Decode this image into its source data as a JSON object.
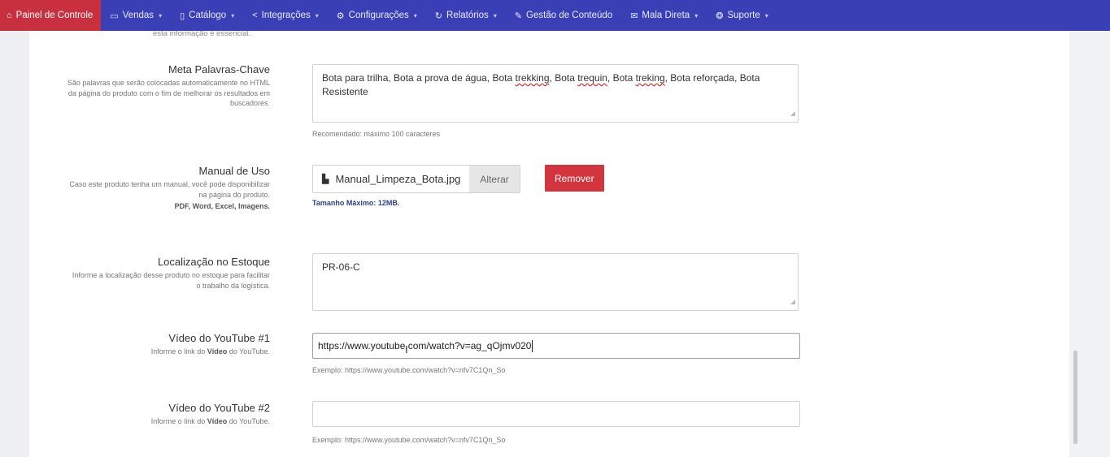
{
  "nav": {
    "items": [
      {
        "label": "Painel de Controle",
        "icon": "home-icon",
        "active": true,
        "has_menu": false
      },
      {
        "label": "Vendas",
        "icon": "cart-icon",
        "active": false,
        "has_menu": true
      },
      {
        "label": "Catálogo",
        "icon": "catalog-icon",
        "active": false,
        "has_menu": true
      },
      {
        "label": "Integrações",
        "icon": "share-icon",
        "active": false,
        "has_menu": true
      },
      {
        "label": "Configurações",
        "icon": "gear-icon",
        "active": false,
        "has_menu": true
      },
      {
        "label": "Relatórios",
        "icon": "history-icon",
        "active": false,
        "has_menu": true
      },
      {
        "label": "Gestão de Conteúdo",
        "icon": "edit-icon",
        "active": false,
        "has_menu": false
      },
      {
        "label": "Mala Direta",
        "icon": "mail-icon",
        "active": false,
        "has_menu": true
      },
      {
        "label": "Suporte",
        "icon": "lifebuoy-icon",
        "active": false,
        "has_menu": true
      }
    ],
    "active_color": "#c9303f",
    "bar_color": "#3a3fb6"
  },
  "cutoff_text": "esta informação é essencial.",
  "meta_keywords": {
    "title": "Meta Palavras-Chave",
    "help": "São palavras que serão colocadas automaticamente no HTML da página do produto com o fim de melhorar os resultados em buscadores.",
    "value_parts": [
      "Bota para trilha, Bota a prova de água, Bota ",
      "trekking",
      ", Bota ",
      "trequin",
      ", Bota ",
      "treking",
      ", Bota reforçada, Bota Resistente"
    ],
    "hint": "Recomendado: máximo 100 caracteres"
  },
  "manual": {
    "title": "Manual de Uso",
    "help": "Caso este produto tenha um manual, você pode disponibilizar na página do produto.",
    "formats": "PDF, Word, Excel, Imagens.",
    "file_name": "Manual_Limpeza_Bota.jpg",
    "change_label": "Alterar",
    "remove_label": "Remover",
    "max_size": "Tamanho Máximo: 12MB."
  },
  "stock_location": {
    "title": "Localização no Estoque",
    "help": "Informe a localização desse produto no estoque para facilitar o trabalho da logística.",
    "value": "PR-06-C"
  },
  "youtube1": {
    "title": "Vídeo do YouTube #1",
    "help_prefix": "Informe o link do ",
    "help_bold": "Vídeo",
    "help_suffix": " do YouTube.",
    "value": "https://www.youtube.com/watch?v=ag_qOjmv020",
    "hint": "Exemplo: https://www.youtube.com/watch?v=nfv7C1Qn_So"
  },
  "youtube2": {
    "title": "Vídeo do YouTube #2",
    "help_prefix": "Informe o link do ",
    "help_bold": "Vídeo",
    "help_suffix": " do YouTube.",
    "value": "",
    "hint": "Exemplo: https://www.youtube.com/watch?v=nfv7C1Qn_So"
  }
}
